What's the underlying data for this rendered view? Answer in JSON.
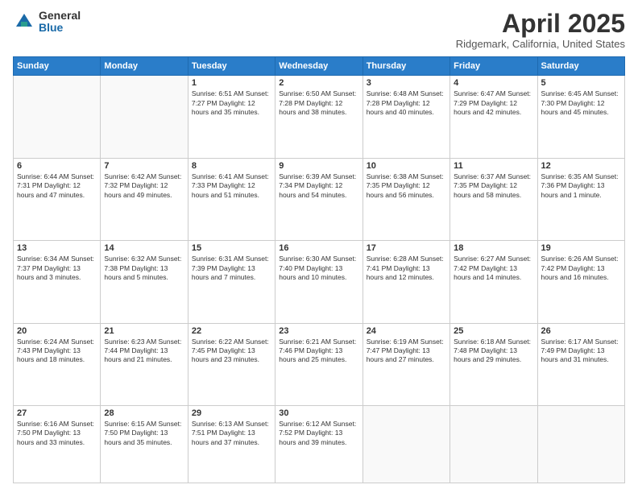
{
  "header": {
    "logo_general": "General",
    "logo_blue": "Blue",
    "title": "April 2025",
    "subtitle": "Ridgemark, California, United States"
  },
  "calendar": {
    "days_of_week": [
      "Sunday",
      "Monday",
      "Tuesday",
      "Wednesday",
      "Thursday",
      "Friday",
      "Saturday"
    ],
    "weeks": [
      [
        {
          "day": "",
          "info": ""
        },
        {
          "day": "",
          "info": ""
        },
        {
          "day": "1",
          "info": "Sunrise: 6:51 AM\nSunset: 7:27 PM\nDaylight: 12 hours\nand 35 minutes."
        },
        {
          "day": "2",
          "info": "Sunrise: 6:50 AM\nSunset: 7:28 PM\nDaylight: 12 hours\nand 38 minutes."
        },
        {
          "day": "3",
          "info": "Sunrise: 6:48 AM\nSunset: 7:28 PM\nDaylight: 12 hours\nand 40 minutes."
        },
        {
          "day": "4",
          "info": "Sunrise: 6:47 AM\nSunset: 7:29 PM\nDaylight: 12 hours\nand 42 minutes."
        },
        {
          "day": "5",
          "info": "Sunrise: 6:45 AM\nSunset: 7:30 PM\nDaylight: 12 hours\nand 45 minutes."
        }
      ],
      [
        {
          "day": "6",
          "info": "Sunrise: 6:44 AM\nSunset: 7:31 PM\nDaylight: 12 hours\nand 47 minutes."
        },
        {
          "day": "7",
          "info": "Sunrise: 6:42 AM\nSunset: 7:32 PM\nDaylight: 12 hours\nand 49 minutes."
        },
        {
          "day": "8",
          "info": "Sunrise: 6:41 AM\nSunset: 7:33 PM\nDaylight: 12 hours\nand 51 minutes."
        },
        {
          "day": "9",
          "info": "Sunrise: 6:39 AM\nSunset: 7:34 PM\nDaylight: 12 hours\nand 54 minutes."
        },
        {
          "day": "10",
          "info": "Sunrise: 6:38 AM\nSunset: 7:35 PM\nDaylight: 12 hours\nand 56 minutes."
        },
        {
          "day": "11",
          "info": "Sunrise: 6:37 AM\nSunset: 7:35 PM\nDaylight: 12 hours\nand 58 minutes."
        },
        {
          "day": "12",
          "info": "Sunrise: 6:35 AM\nSunset: 7:36 PM\nDaylight: 13 hours\nand 1 minute."
        }
      ],
      [
        {
          "day": "13",
          "info": "Sunrise: 6:34 AM\nSunset: 7:37 PM\nDaylight: 13 hours\nand 3 minutes."
        },
        {
          "day": "14",
          "info": "Sunrise: 6:32 AM\nSunset: 7:38 PM\nDaylight: 13 hours\nand 5 minutes."
        },
        {
          "day": "15",
          "info": "Sunrise: 6:31 AM\nSunset: 7:39 PM\nDaylight: 13 hours\nand 7 minutes."
        },
        {
          "day": "16",
          "info": "Sunrise: 6:30 AM\nSunset: 7:40 PM\nDaylight: 13 hours\nand 10 minutes."
        },
        {
          "day": "17",
          "info": "Sunrise: 6:28 AM\nSunset: 7:41 PM\nDaylight: 13 hours\nand 12 minutes."
        },
        {
          "day": "18",
          "info": "Sunrise: 6:27 AM\nSunset: 7:42 PM\nDaylight: 13 hours\nand 14 minutes."
        },
        {
          "day": "19",
          "info": "Sunrise: 6:26 AM\nSunset: 7:42 PM\nDaylight: 13 hours\nand 16 minutes."
        }
      ],
      [
        {
          "day": "20",
          "info": "Sunrise: 6:24 AM\nSunset: 7:43 PM\nDaylight: 13 hours\nand 18 minutes."
        },
        {
          "day": "21",
          "info": "Sunrise: 6:23 AM\nSunset: 7:44 PM\nDaylight: 13 hours\nand 21 minutes."
        },
        {
          "day": "22",
          "info": "Sunrise: 6:22 AM\nSunset: 7:45 PM\nDaylight: 13 hours\nand 23 minutes."
        },
        {
          "day": "23",
          "info": "Sunrise: 6:21 AM\nSunset: 7:46 PM\nDaylight: 13 hours\nand 25 minutes."
        },
        {
          "day": "24",
          "info": "Sunrise: 6:19 AM\nSunset: 7:47 PM\nDaylight: 13 hours\nand 27 minutes."
        },
        {
          "day": "25",
          "info": "Sunrise: 6:18 AM\nSunset: 7:48 PM\nDaylight: 13 hours\nand 29 minutes."
        },
        {
          "day": "26",
          "info": "Sunrise: 6:17 AM\nSunset: 7:49 PM\nDaylight: 13 hours\nand 31 minutes."
        }
      ],
      [
        {
          "day": "27",
          "info": "Sunrise: 6:16 AM\nSunset: 7:50 PM\nDaylight: 13 hours\nand 33 minutes."
        },
        {
          "day": "28",
          "info": "Sunrise: 6:15 AM\nSunset: 7:50 PM\nDaylight: 13 hours\nand 35 minutes."
        },
        {
          "day": "29",
          "info": "Sunrise: 6:13 AM\nSunset: 7:51 PM\nDaylight: 13 hours\nand 37 minutes."
        },
        {
          "day": "30",
          "info": "Sunrise: 6:12 AM\nSunset: 7:52 PM\nDaylight: 13 hours\nand 39 minutes."
        },
        {
          "day": "",
          "info": ""
        },
        {
          "day": "",
          "info": ""
        },
        {
          "day": "",
          "info": ""
        }
      ]
    ]
  }
}
